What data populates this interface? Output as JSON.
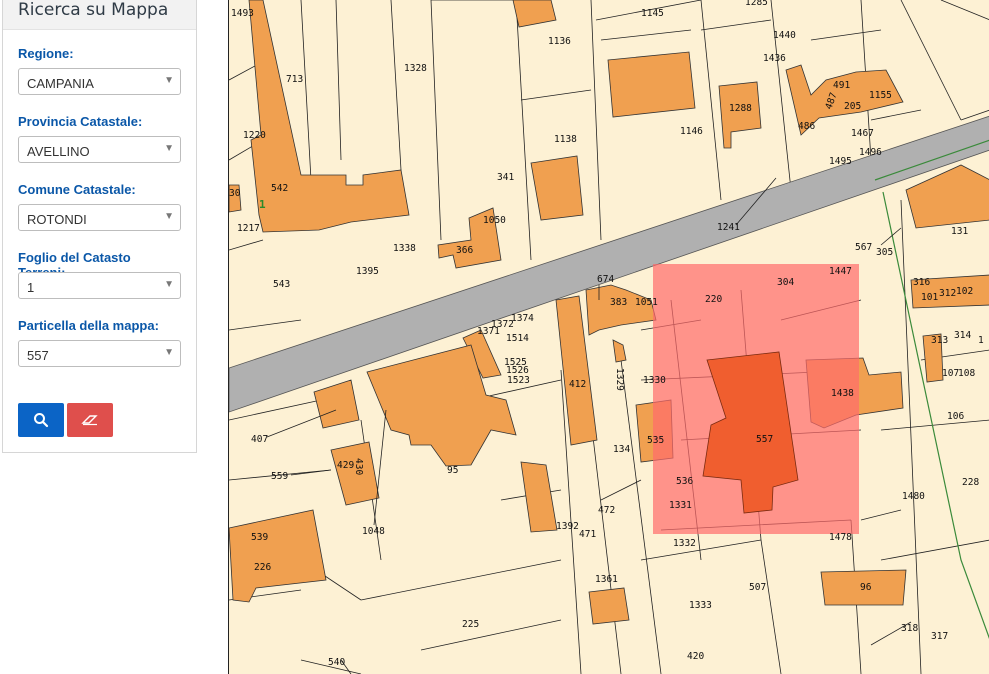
{
  "panel": {
    "title": "Ricerca su Mappa",
    "fields": [
      {
        "label": "Regione:",
        "value": "CAMPANIA"
      },
      {
        "label": "Provincia Catastale:",
        "value": "AVELLINO"
      },
      {
        "label": "Comune Catastale:",
        "value": "ROTONDI"
      },
      {
        "label": "Foglio del Catasto Terreni:",
        "value": "1"
      },
      {
        "label": "Particella della mappa:",
        "value": "557"
      }
    ],
    "buttons": {
      "search_icon": "search-icon",
      "clear_icon": "eraser-icon"
    }
  },
  "map": {
    "colors": {
      "background": "#fdf1d4",
      "building": "#f0a050",
      "road": "#b0b0b0",
      "highlight": "#ff6b6b",
      "selected_building": "#f06030"
    },
    "sheet_label": "1",
    "parcel_labels": [
      {
        "text": "1493"
      },
      {
        "text": "713"
      },
      {
        "text": "1220"
      },
      {
        "text": "542"
      },
      {
        "text": "1217"
      },
      {
        "text": "30"
      },
      {
        "text": "543"
      },
      {
        "text": "1328"
      },
      {
        "text": "1395"
      },
      {
        "text": "1338"
      },
      {
        "text": "1136"
      },
      {
        "text": "1145"
      },
      {
        "text": "1285"
      },
      {
        "text": "1440"
      },
      {
        "text": "1436"
      },
      {
        "text": "491"
      },
      {
        "text": "487"
      },
      {
        "text": "205"
      },
      {
        "text": "1155"
      },
      {
        "text": "486"
      },
      {
        "text": "1288"
      },
      {
        "text": "1146"
      },
      {
        "text": "1138"
      },
      {
        "text": "341"
      },
      {
        "text": "1050"
      },
      {
        "text": "366"
      },
      {
        "text": "1467"
      },
      {
        "text": "1496"
      },
      {
        "text": "1495"
      },
      {
        "text": "1241"
      },
      {
        "text": "567"
      },
      {
        "text": "305"
      },
      {
        "text": "131"
      },
      {
        "text": "674"
      },
      {
        "text": "383"
      },
      {
        "text": "1051"
      },
      {
        "text": "220"
      },
      {
        "text": "304"
      },
      {
        "text": "1447"
      },
      {
        "text": "316"
      },
      {
        "text": "101"
      },
      {
        "text": "312"
      },
      {
        "text": "102"
      },
      {
        "text": "1374"
      },
      {
        "text": "1372"
      },
      {
        "text": "1371"
      },
      {
        "text": "1514"
      },
      {
        "text": "1525"
      },
      {
        "text": "1526"
      },
      {
        "text": "1523"
      },
      {
        "text": "412"
      },
      {
        "text": "1329"
      },
      {
        "text": "1330"
      },
      {
        "text": "313"
      },
      {
        "text": "314"
      },
      {
        "text": "1"
      },
      {
        "text": "107"
      },
      {
        "text": "108"
      },
      {
        "text": "1438"
      },
      {
        "text": "106"
      },
      {
        "text": "407"
      },
      {
        "text": "95"
      },
      {
        "text": "134"
      },
      {
        "text": "535"
      },
      {
        "text": "557"
      },
      {
        "text": "429"
      },
      {
        "text": "430"
      },
      {
        "text": "559"
      },
      {
        "text": "536"
      },
      {
        "text": "1331"
      },
      {
        "text": "472"
      },
      {
        "text": "1392"
      },
      {
        "text": "471"
      },
      {
        "text": "1480"
      },
      {
        "text": "228"
      },
      {
        "text": "1048"
      },
      {
        "text": "539"
      },
      {
        "text": "226"
      },
      {
        "text": "1332"
      },
      {
        "text": "1478"
      },
      {
        "text": "1361"
      },
      {
        "text": "507"
      },
      {
        "text": "96"
      },
      {
        "text": "1333"
      },
      {
        "text": "225"
      },
      {
        "text": "318"
      },
      {
        "text": "317"
      },
      {
        "text": "540"
      },
      {
        "text": "420"
      }
    ]
  }
}
